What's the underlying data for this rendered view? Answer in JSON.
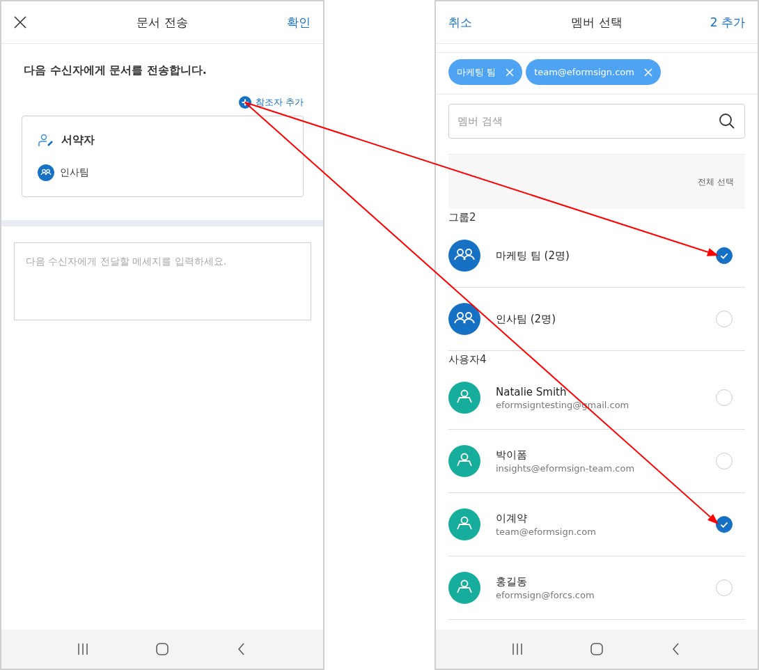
{
  "send_screen": {
    "header": {
      "title": "문서 전송",
      "confirm": "확인"
    },
    "intro": "다음 수신자에게 문서를 전송합니다.",
    "add_cc": "참조자 추가",
    "recipient_card": {
      "role": "서약자",
      "members": [
        {
          "name": "인사팀",
          "kind": "group"
        }
      ]
    },
    "message": {
      "placeholder": "다음 수신자에게 전달할 메세지를 입력하세요."
    }
  },
  "member_screen": {
    "header": {
      "cancel": "취소",
      "title": "멤버 선택",
      "add": "2 추가"
    },
    "chips": [
      {
        "label": "마케팅 팀"
      },
      {
        "label": "team@eformsign.com"
      }
    ],
    "search": {
      "placeholder": "멤버 검색"
    },
    "select_all": "전체 선택",
    "sections": [
      {
        "title": "그룹2",
        "items": [
          {
            "kind": "group",
            "name": "마케팅 팀 (2명)",
            "selected": true,
            "callout_arrow": true
          },
          {
            "kind": "group",
            "name": "인사팀 (2명)",
            "selected": false,
            "callout_arrow": false
          }
        ]
      },
      {
        "title": "사용자4",
        "items": [
          {
            "kind": "user",
            "name": "Natalie Smith",
            "email": "eformsigntesting@gmail.com",
            "selected": false,
            "callout_arrow": false
          },
          {
            "kind": "user",
            "name": "박이폼",
            "email": "insights@eformsign-team.com",
            "selected": false,
            "callout_arrow": false
          },
          {
            "kind": "user",
            "name": "이계약",
            "email": "team@eformsign.com",
            "selected": true,
            "callout_arrow": true
          },
          {
            "kind": "user",
            "name": "홍길동",
            "email": "eformsign@forcs.com",
            "selected": false,
            "callout_arrow": false
          }
        ]
      }
    ]
  }
}
